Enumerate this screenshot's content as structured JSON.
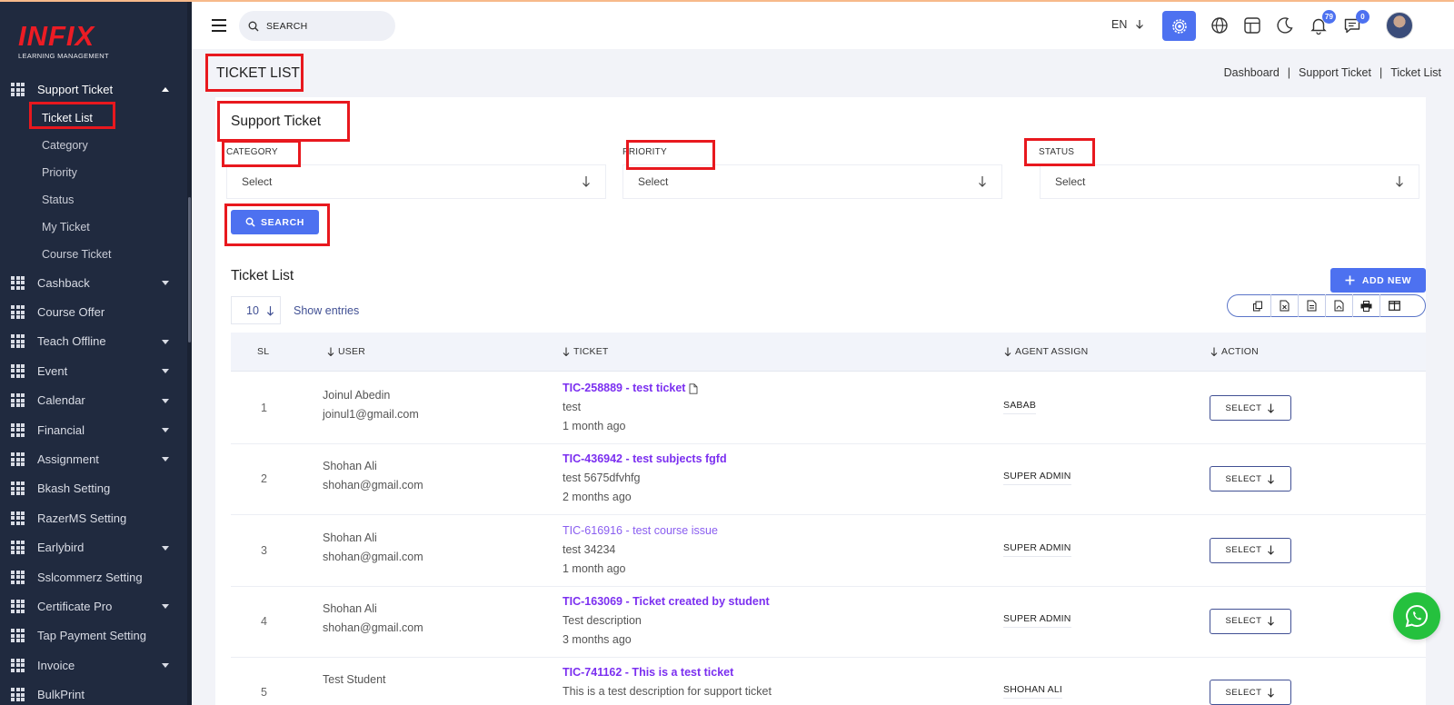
{
  "brand": {
    "logo_text": "INFIX",
    "tagline": "LEARNING MANAGEMENT"
  },
  "sidebar": {
    "active_group": {
      "label": "Support Ticket",
      "children": [
        "Ticket List",
        "Category",
        "Priority",
        "Status",
        "My Ticket",
        "Course Ticket"
      ]
    },
    "items": [
      {
        "label": "Cashback",
        "has_submenu": true
      },
      {
        "label": "Course Offer",
        "has_submenu": false
      },
      {
        "label": "Teach Offline",
        "has_submenu": true
      },
      {
        "label": "Event",
        "has_submenu": true
      },
      {
        "label": "Calendar",
        "has_submenu": true
      },
      {
        "label": "Financial",
        "has_submenu": true
      },
      {
        "label": "Assignment",
        "has_submenu": true
      },
      {
        "label": "Bkash Setting",
        "has_submenu": false
      },
      {
        "label": "RazerMS Setting",
        "has_submenu": false
      },
      {
        "label": "Earlybird",
        "has_submenu": true
      },
      {
        "label": "Sslcommerz Setting",
        "has_submenu": false
      },
      {
        "label": "Certificate Pro",
        "has_submenu": true
      },
      {
        "label": "Tap Payment Setting",
        "has_submenu": false
      },
      {
        "label": "Invoice",
        "has_submenu": true
      },
      {
        "label": "BulkPrint",
        "has_submenu": false
      }
    ]
  },
  "header": {
    "search_placeholder": "SEARCH",
    "language": "EN",
    "notifications_count": "79",
    "messages_count": "0"
  },
  "page": {
    "title": "TICKET LIST",
    "breadcrumb": [
      "Dashboard",
      "Support Ticket",
      "Ticket List"
    ]
  },
  "filter": {
    "title": "Support Ticket",
    "fields": [
      {
        "label": "CATEGORY",
        "value": "Select"
      },
      {
        "label": "PRIORITY",
        "value": "Select"
      },
      {
        "label": "STATUS",
        "value": "Select"
      }
    ],
    "search_label": "SEARCH"
  },
  "table": {
    "title": "Ticket List",
    "add_new_label": "ADD NEW",
    "entries_value": "10",
    "show_entries_label": "Show entries",
    "columns": [
      "SL",
      "USER",
      "TICKET",
      "AGENT ASSIGN",
      "ACTION"
    ],
    "action_label": "SELECT",
    "rows": [
      {
        "sl": "1",
        "name": "Joinul Abedin",
        "email": "joinul1@gmail.com",
        "ticket": "TIC-258889 - test ticket",
        "has_attachment": true,
        "desc": "test",
        "time": "1 month ago",
        "agent": "SABAB",
        "link_style": "bold"
      },
      {
        "sl": "2",
        "name": "Shohan Ali",
        "email": "shohan@gmail.com",
        "ticket": "TIC-436942 - test subjects fgfd",
        "has_attachment": false,
        "desc": "test 5675dfvhfg",
        "time": "2 months ago",
        "agent": "SUPER ADMIN",
        "link_style": "bold"
      },
      {
        "sl": "3",
        "name": "Shohan Ali",
        "email": "shohan@gmail.com",
        "ticket": "TIC-616916 - test course issue",
        "has_attachment": false,
        "desc": "test 34234",
        "time": "1 month ago",
        "agent": "SUPER ADMIN",
        "link_style": "light"
      },
      {
        "sl": "4",
        "name": "Shohan Ali",
        "email": "shohan@gmail.com",
        "ticket": "TIC-163069 - Ticket created by student",
        "has_attachment": false,
        "desc": "Test description",
        "time": "3 months ago",
        "agent": "SUPER ADMIN",
        "link_style": "bold"
      },
      {
        "sl": "5",
        "name": "Test Student",
        "email": "",
        "ticket": "TIC-741162 - This is a test ticket",
        "has_attachment": false,
        "desc": "This is a test description for support ticket",
        "time": "",
        "agent": "SHOHAN ALI",
        "link_style": "bold"
      }
    ]
  },
  "colors": {
    "primary": "#4d71f0",
    "sidebar_bg": "#202a3f",
    "link": "#7b2ff0",
    "annotation": "#e8181e",
    "whatsapp": "#25c13e"
  }
}
